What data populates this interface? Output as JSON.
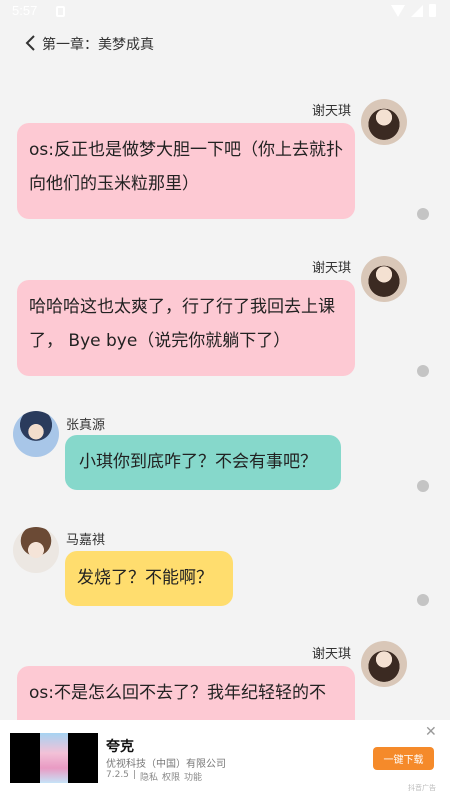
{
  "status_bar": {
    "time": "5:57"
  },
  "header": {
    "title": "第一章：美梦成真"
  },
  "messages": [
    {
      "speaker": "谢天琪",
      "text": "os:反正也是做梦大胆一下吧（你上去就扑向他们的玉米粒那里）",
      "side": "right",
      "color": "#fdc9d3"
    },
    {
      "speaker": "谢天琪",
      "text": "哈哈哈这也太爽了，行了行了我回去上课了， Bye bye（说完你就躺下了）",
      "side": "right",
      "color": "#fdc9d3"
    },
    {
      "speaker": "张真源",
      "text": "小琪你到底咋了？不会有事吧？",
      "side": "left",
      "color": "#86d8cb"
    },
    {
      "speaker": "马嘉祺",
      "text": "发烧了？不能啊？",
      "side": "left",
      "color": "#ffdd6e"
    },
    {
      "speaker": "谢天琪",
      "text": "os:不是怎么回不去了？我年纪轻轻的不",
      "side": "right",
      "color": "#fdc9d3"
    }
  ],
  "ad": {
    "title": "夸克",
    "company": "优视科技（中国）有限公司",
    "version": "7.2.5",
    "privacy": "隐私",
    "permissions": "权限",
    "features": "功能",
    "download_label": "一键下载",
    "ad_label": "抖音广告"
  },
  "colors": {
    "background": "#f3f3f3",
    "pink": "#fdc9d3",
    "teal": "#86d8cb",
    "yellow": "#ffdd6e",
    "download": "#f58a2a"
  }
}
